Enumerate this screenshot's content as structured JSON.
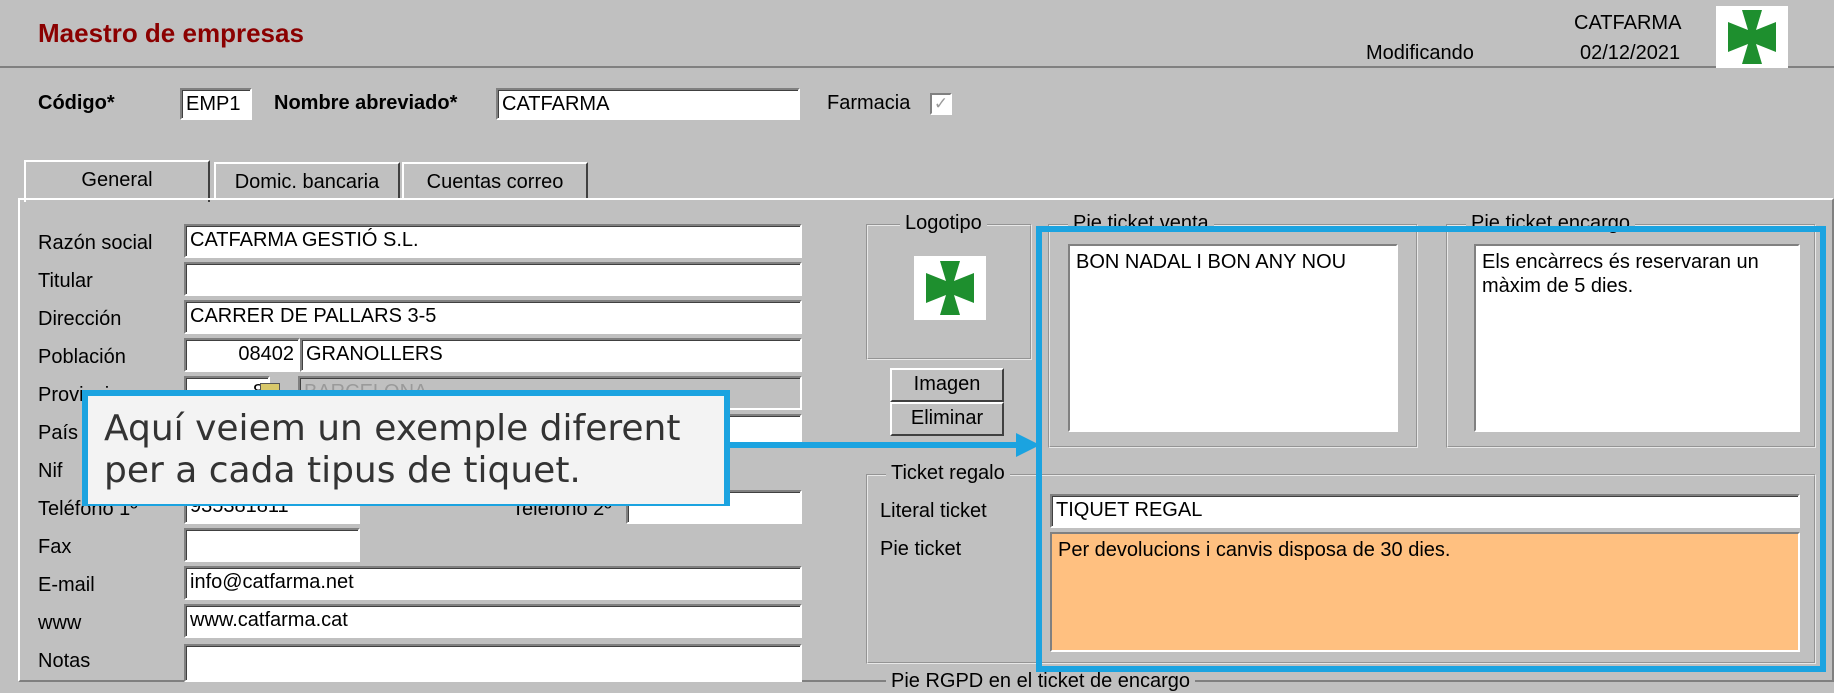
{
  "header": {
    "title": "Maestro de empresas",
    "mode": "Modificando",
    "company": "CATFARMA",
    "date": "02/12/2021",
    "brand_color": "#8b0000",
    "logo_icon": "green-cross-icon"
  },
  "top_fields": {
    "codigo_label": "Código*",
    "codigo_value": "EMP1",
    "nombre_label": "Nombre abreviado*",
    "nombre_value": "CATFARMA",
    "farmacia_label": "Farmacia",
    "farmacia_checked": "✓"
  },
  "tabs": [
    {
      "label": "General"
    },
    {
      "label": "Domic. bancaria"
    },
    {
      "label": "Cuentas correo"
    }
  ],
  "general": {
    "razon_label": "Razón social",
    "razon_value": "CATFARMA GESTIÓ S.L.",
    "titular_label": "Titular",
    "titular_value": "",
    "direccion_label": "Dirección",
    "direccion_value": "CARRER DE PALLARS 3-5",
    "poblacion_label": "Población",
    "cp_value": "08402",
    "poblacion_value": "GRANOLLERS",
    "provincia_label": "Provincia",
    "provincia_code": "8",
    "provincia_value": "BARCELONA",
    "pais_label": "País",
    "nif_label": "Nif",
    "telefono1_label": "Teléfono 1º",
    "telefono1_value": "935381811",
    "telefono2_label": "Teléfono 2º",
    "telefono2_value": "",
    "fax_label": "Fax",
    "fax_value": "",
    "email_label": "E-mail",
    "email_value": "info@catfarma.net",
    "www_label": "www",
    "www_value": "www.catfarma.cat",
    "notas_label": "Notas"
  },
  "logotipo": {
    "legend": "Logotipo",
    "imagen_button": "Imagen",
    "eliminar_button": "Eliminar"
  },
  "pie_venta": {
    "legend": "Pie ticket venta",
    "text": "BON NADAL I BON ANY NOU"
  },
  "pie_encargo": {
    "legend": "Pie ticket encargo",
    "text": "Els encàrrecs és reservaran un màxim de 5 dies."
  },
  "ticket_regalo": {
    "legend": "Ticket regalo",
    "literal_label": "Literal ticket",
    "literal_value": "TIQUET REGAL",
    "pie_label": "Pie ticket",
    "pie_value": "Per devolucions i canvis disposa de 30 dies.",
    "highlight_color": "#ffc080"
  },
  "rgpd": {
    "legend": "Pie RGPD en el ticket de encargo"
  },
  "annotation": {
    "text": "Aquí veiem un exemple diferent per a cada tipus de tiquet.",
    "color": "#1ba3e0"
  }
}
